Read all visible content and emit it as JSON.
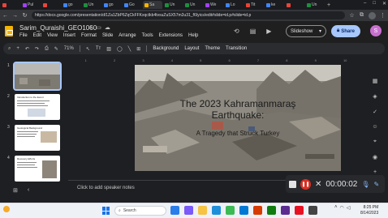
{
  "browser": {
    "tabs": [
      {
        "label": "",
        "color": "#e8453c"
      },
      {
        "label": "Pul",
        "color": "#a142f4"
      },
      {
        "label": "",
        "color": "#e8453c"
      },
      {
        "label": "go",
        "color": "#4285f4"
      },
      {
        "label": "Un",
        "color": "#1e8e3e"
      },
      {
        "label": "go",
        "color": "#4285f4"
      },
      {
        "label": "Go",
        "color": "#4285f4"
      },
      {
        "label": "Sa",
        "color": "#f4b400"
      },
      {
        "label": "Un",
        "color": "#1e8e3e"
      },
      {
        "label": "Un",
        "color": "#1e8e3e"
      },
      {
        "label": "We",
        "color": "#a142f4"
      },
      {
        "label": "Lo",
        "color": "#4285f4"
      },
      {
        "label": "Tit",
        "color": "#ea4335"
      },
      {
        "label": "ke",
        "color": "#4285f4"
      },
      {
        "label": "",
        "color": "#e8453c"
      },
      {
        "label": "Un",
        "color": "#1e8e3e"
      }
    ],
    "url": "https://docs.google.com/presentation/d/1Za1ZbP6ZqCkFFKxqctkb4tvsuZuSX57m2u31_f6Iyics/edit#slide=id.p#slide=id.p"
  },
  "app": {
    "doc_title": "Sarim_Quraishi_GEO1060",
    "menu": [
      "File",
      "Edit",
      "View",
      "Insert",
      "Format",
      "Slide",
      "Arrange",
      "Tools",
      "Extensions",
      "Help"
    ],
    "slideshow_label": "Slideshow",
    "share_label": "Share",
    "avatar_letter": "S"
  },
  "toolbar": {
    "zoom": "71%",
    "background_label": "Background",
    "layout_label": "Layout",
    "theme_label": "Theme",
    "transition_label": "Transition"
  },
  "filmstrip": {
    "slides": [
      {
        "num": "1",
        "title": ""
      },
      {
        "num": "2",
        "title": "Introduction to the Event"
      },
      {
        "num": "3",
        "title": "Geological Background"
      },
      {
        "num": "4",
        "title": "Recovery Efforts"
      }
    ]
  },
  "slide": {
    "title": "The 2023 Kahramanmaraş Earthquake:",
    "subtitle": "A Tragedy that Struck Turkey"
  },
  "notes": {
    "placeholder": "Click to add speaker notes"
  },
  "recorder": {
    "time": "00:00:02"
  },
  "taskbar": {
    "weather_temp": "",
    "search_placeholder": "Search",
    "time": "8:25 PM",
    "date": "8/14/2023"
  }
}
